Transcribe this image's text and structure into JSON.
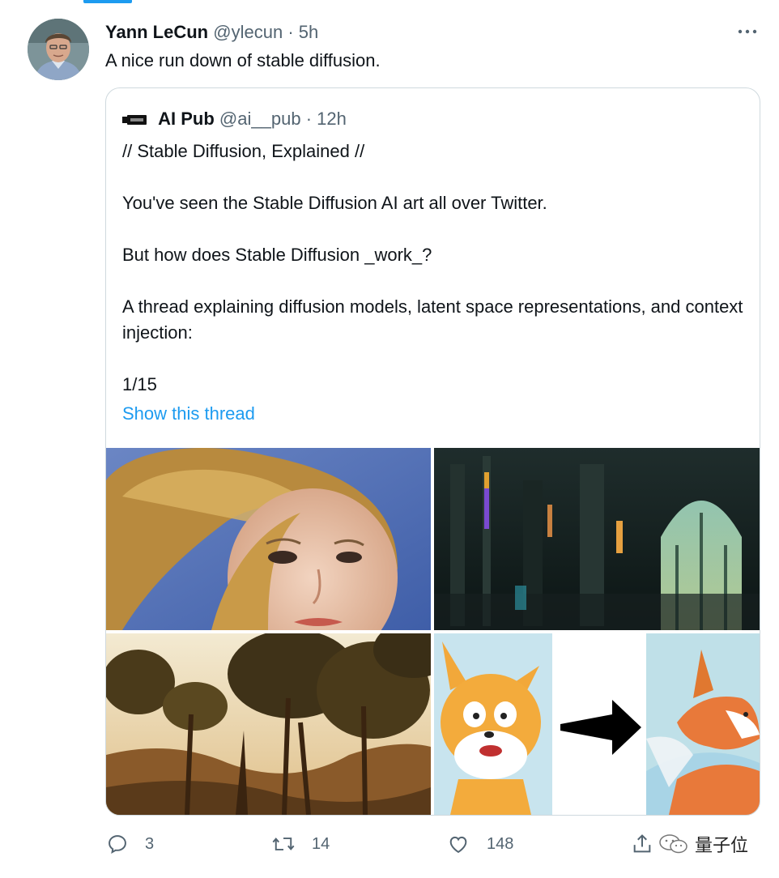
{
  "tweet": {
    "author_name": "Yann LeCun",
    "author_handle": "@ylecun",
    "separator": "·",
    "time": "5h",
    "text": "A nice run down of stable diffusion."
  },
  "quoted": {
    "author_name": "AI Pub",
    "author_handle": "@ai__pub",
    "separator": "·",
    "time": "12h",
    "lines": [
      "// Stable Diffusion, Explained //",
      "You've seen the Stable Diffusion AI art all over Twitter.",
      "But how does Stable Diffusion _work_?",
      "A thread explaining diffusion models, latent space representations, and context injection:",
      "1/15"
    ],
    "show_thread": "Show this thread"
  },
  "actions": {
    "replies": "3",
    "retweets": "14",
    "likes": "148"
  },
  "watermark": "量子位",
  "colors": {
    "accent": "#1d9bf0",
    "secondary_text": "#536471",
    "border": "#cfd9de"
  },
  "icons": [
    "more-icon",
    "reply-icon",
    "retweet-icon",
    "like-icon",
    "share-icon",
    "ai-pub-logo",
    "wechat-icon"
  ]
}
